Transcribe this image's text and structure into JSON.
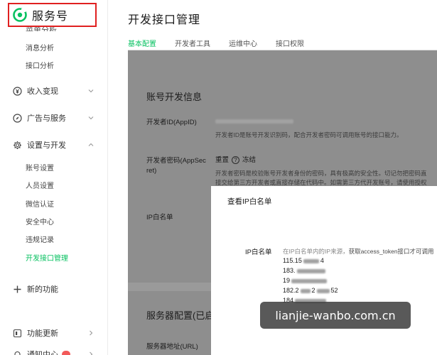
{
  "brand": {
    "title": "服务号",
    "cut_item": "菜单分析"
  },
  "sidebar": {
    "top_items": [
      "消息分析",
      "接口分析"
    ],
    "groups": {
      "revenue": "收入变现",
      "ads": "广告与服务",
      "settings": "设置与开发",
      "features": "新的功能",
      "updates": "功能更新",
      "notifications": "通知中心"
    },
    "settings_items": [
      "账号设置",
      "人员设置",
      "微信认证",
      "安全中心",
      "违规记录",
      "开发接口管理"
    ]
  },
  "header": {
    "title": "开发接口管理",
    "tabs": [
      "基本配置",
      "开发者工具",
      "运维中心",
      "接口权限"
    ]
  },
  "account_dev": {
    "section_title": "账号开发信息",
    "appid_label": "开发者ID(AppID)",
    "appid_desc": "开发者ID是账号开发识别码，配合开发者密码可调用账号的接口能力。",
    "secret_label_1": "开发者密码(AppSec",
    "secret_label_2": "ret)",
    "secret_reset": "重置",
    "secret_freeze": "冻结",
    "secret_desc_1": "开发者密码是校验账号开发者身份的密码，具有极高的安全性。切记勿把密码直",
    "secret_desc_2": "接交给第三方开发者或直接存储在代码中。如需第三方代开发账号，请使用授权",
    "ip_label": "IP白名单"
  },
  "server": {
    "section_title": "服务器配置(已启用)",
    "url_label": "服务器地址(URL)"
  },
  "modal": {
    "title": "查看IP白名单",
    "label": "IP白名单",
    "desc_prefix": "在IP白名单内的IP来源，",
    "desc_link": "获取access_token接口才可调用",
    "ips": [
      "115.15",
      "183.",
      "19",
      "182.2",
      "184"
    ],
    "ip_tails": [
      "4",
      "",
      "",
      "2",
      ""
    ],
    "ip_mid": [
      "",
      "",
      "",
      "2",
      ""
    ],
    "ip_end": [
      "",
      "",
      "",
      "52",
      ""
    ]
  },
  "watermark": "lianjie-wanbo.com.cn",
  "colors": {
    "accent": "#07c160",
    "brand_border": "#e02020",
    "overlay": "#8e8e8e"
  }
}
